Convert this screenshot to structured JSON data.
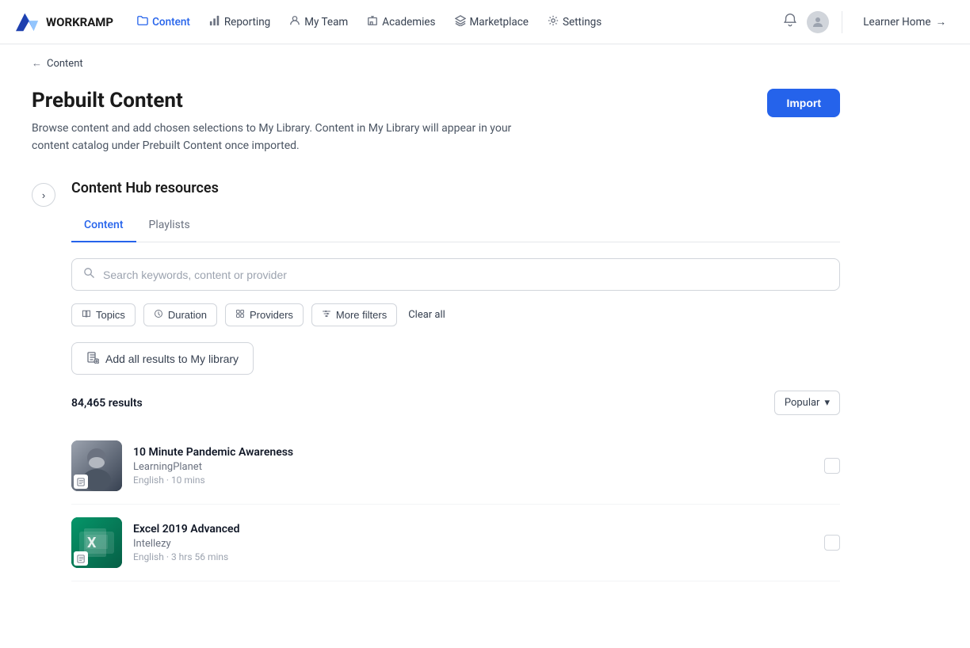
{
  "app": {
    "name": "WORKRAMP"
  },
  "nav": {
    "items": [
      {
        "id": "content",
        "label": "Content",
        "active": true,
        "icon": "folder"
      },
      {
        "id": "reporting",
        "label": "Reporting",
        "active": false,
        "icon": "chart"
      },
      {
        "id": "my-team",
        "label": "My Team",
        "active": false,
        "icon": "person"
      },
      {
        "id": "academies",
        "label": "Academies",
        "active": false,
        "icon": "building"
      },
      {
        "id": "marketplace",
        "label": "Marketplace",
        "active": false,
        "icon": "layers"
      },
      {
        "id": "settings",
        "label": "Settings",
        "active": false,
        "icon": "gear"
      }
    ],
    "learner_home": "Learner Home"
  },
  "breadcrumb": {
    "back_arrow": "←",
    "link": "Content"
  },
  "page": {
    "title": "Prebuilt Content",
    "description": "Browse content and add chosen selections to My Library. Content in My Library will appear in your content catalog under Prebuilt Content once imported.",
    "import_button": "Import"
  },
  "content_hub": {
    "title": "Content Hub resources",
    "collapse_icon": "›",
    "tabs": [
      {
        "id": "content",
        "label": "Content",
        "active": true
      },
      {
        "id": "playlists",
        "label": "Playlists",
        "active": false
      }
    ],
    "search": {
      "placeholder": "Search keywords, content or provider"
    },
    "filters": [
      {
        "id": "topics",
        "label": "Topics",
        "icon": "📖"
      },
      {
        "id": "duration",
        "label": "Duration",
        "icon": "🕐"
      },
      {
        "id": "providers",
        "label": "Providers",
        "icon": "⊞"
      },
      {
        "id": "more-filters",
        "label": "More filters",
        "icon": "⚙"
      }
    ],
    "clear_all": "Clear all",
    "add_all_button": "Add all results to My library",
    "results_count": "84,465 results",
    "sort": {
      "label": "Popular",
      "icon": "▾"
    },
    "items": [
      {
        "id": "item-1",
        "title": "10 Minute Pandemic Awareness",
        "provider": "LearningPlanet",
        "language": "English",
        "duration": "10 mins",
        "thumbnail_type": "pandemic"
      },
      {
        "id": "item-2",
        "title": "Excel 2019 Advanced",
        "provider": "Intellezy",
        "language": "English",
        "duration": "3 hrs 56 mins",
        "thumbnail_type": "excel"
      }
    ]
  }
}
